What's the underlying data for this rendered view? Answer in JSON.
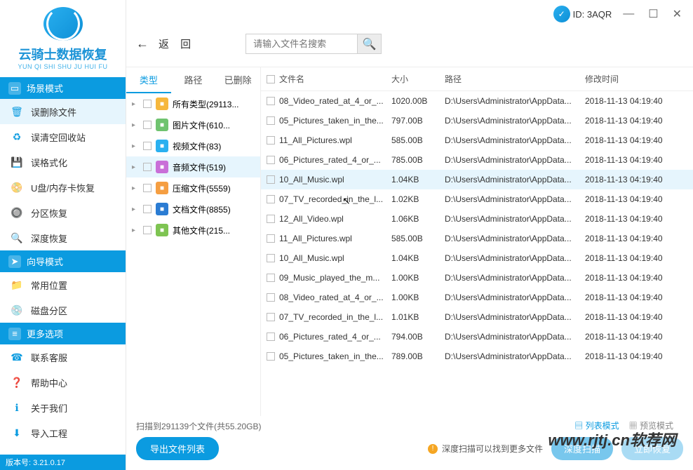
{
  "logo": {
    "title": "云骑士数据恢复",
    "sub": "YUN QI SHI SHU JU HUI FU"
  },
  "titlebar": {
    "id_label": "ID: 3AQR"
  },
  "toolbar": {
    "back": "返  回",
    "search_placeholder": "请输入文件名搜索"
  },
  "sidebar": {
    "scene_header": "场景模式",
    "scene": [
      "误删除文件",
      "误清空回收站",
      "误格式化",
      "U盘/内存卡恢复",
      "分区恢复",
      "深度恢复"
    ],
    "wizard_header": "向导模式",
    "wizard": [
      "常用位置",
      "磁盘分区"
    ],
    "more_header": "更多选项",
    "more": [
      "联系客服",
      "帮助中心",
      "关于我们",
      "导入工程"
    ],
    "version_label": "版本号: 3.21.0.17"
  },
  "type_tabs": {
    "type": "类型",
    "path": "路径",
    "deleted": "已删除"
  },
  "type_list": [
    {
      "label": "所有类型(29113...",
      "color": "#f6b73c"
    },
    {
      "label": "图片文件(610...",
      "color": "#6fc36f"
    },
    {
      "label": "视频文件(83)",
      "color": "#2ab0f0"
    },
    {
      "label": "音频文件(519)",
      "color": "#c96fd8",
      "selected": true
    },
    {
      "label": "压缩文件(5559)",
      "color": "#f59e42"
    },
    {
      "label": "文档文件(8855)",
      "color": "#2b7cd3"
    },
    {
      "label": "其他文件(215...",
      "color": "#7ec452"
    }
  ],
  "file_headers": {
    "name": "文件名",
    "size": "大小",
    "path": "路径",
    "time": "修改时间"
  },
  "files": [
    {
      "name": "08_Video_rated_at_4_or_...",
      "size": "1020.00B",
      "path": "D:\\Users\\Administrator\\AppData...",
      "time": "2018-11-13 04:19:40"
    },
    {
      "name": "05_Pictures_taken_in_the...",
      "size": "797.00B",
      "path": "D:\\Users\\Administrator\\AppData...",
      "time": "2018-11-13 04:19:40"
    },
    {
      "name": "11_All_Pictures.wpl",
      "size": "585.00B",
      "path": "D:\\Users\\Administrator\\AppData...",
      "time": "2018-11-13 04:19:40"
    },
    {
      "name": "06_Pictures_rated_4_or_...",
      "size": "785.00B",
      "path": "D:\\Users\\Administrator\\AppData...",
      "time": "2018-11-13 04:19:40"
    },
    {
      "name": "10_All_Music.wpl",
      "size": "1.04KB",
      "path": "D:\\Users\\Administrator\\AppData...",
      "time": "2018-11-13 04:19:40",
      "hl": true
    },
    {
      "name": "07_TV_recorded_in_the_l...",
      "size": "1.02KB",
      "path": "D:\\Users\\Administrator\\AppData...",
      "time": "2018-11-13 04:19:40"
    },
    {
      "name": "12_All_Video.wpl",
      "size": "1.06KB",
      "path": "D:\\Users\\Administrator\\AppData...",
      "time": "2018-11-13 04:19:40"
    },
    {
      "name": "11_All_Pictures.wpl",
      "size": "585.00B",
      "path": "D:\\Users\\Administrator\\AppData...",
      "time": "2018-11-13 04:19:40"
    },
    {
      "name": "10_All_Music.wpl",
      "size": "1.04KB",
      "path": "D:\\Users\\Administrator\\AppData...",
      "time": "2018-11-13 04:19:40"
    },
    {
      "name": "09_Music_played_the_m...",
      "size": "1.00KB",
      "path": "D:\\Users\\Administrator\\AppData...",
      "time": "2018-11-13 04:19:40"
    },
    {
      "name": "08_Video_rated_at_4_or_...",
      "size": "1.00KB",
      "path": "D:\\Users\\Administrator\\AppData...",
      "time": "2018-11-13 04:19:40"
    },
    {
      "name": "07_TV_recorded_in_the_l...",
      "size": "1.01KB",
      "path": "D:\\Users\\Administrator\\AppData...",
      "time": "2018-11-13 04:19:40"
    },
    {
      "name": "06_Pictures_rated_4_or_...",
      "size": "794.00B",
      "path": "D:\\Users\\Administrator\\AppData...",
      "time": "2018-11-13 04:19:40"
    },
    {
      "name": "05_Pictures_taken_in_the...",
      "size": "789.00B",
      "path": "D:\\Users\\Administrator\\AppData...",
      "time": "2018-11-13 04:19:40"
    }
  ],
  "footer": {
    "scan_info": "扫描到291139个文件(共55.20GB)",
    "export_btn": "导出文件列表",
    "deep_hint": "深度扫描可以找到更多文件",
    "deep_btn": "深度扫描",
    "recover_btn": "立即恢复",
    "view_list": "列表模式",
    "view_preview": "预览模式"
  },
  "watermark": "www.rjtj.cn软荐网"
}
